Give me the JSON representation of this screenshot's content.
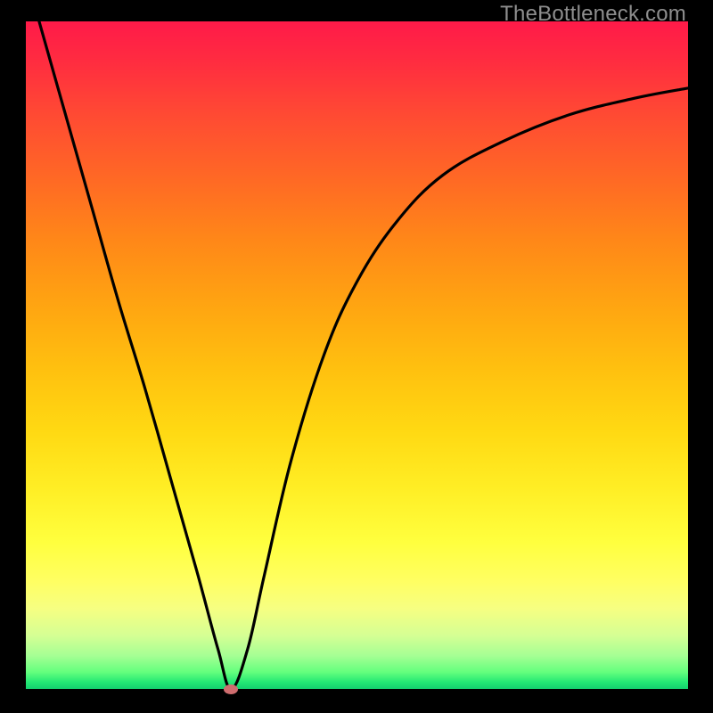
{
  "watermark": "TheBottleneck.com",
  "chart_data": {
    "type": "line",
    "title": "",
    "xlabel": "",
    "ylabel": "",
    "xlim": [
      0,
      100
    ],
    "ylim": [
      0,
      100
    ],
    "grid": false,
    "note": "V-shaped bottleneck curve. x is relative horizontal position (0=left,100=right), y is curve height (0=bottom,100=top). Minimum at x≈31.",
    "series": [
      {
        "name": "bottleneck-curve",
        "x": [
          2,
          6,
          10,
          14,
          18,
          22,
          26,
          29,
          31,
          33.5,
          36,
          40,
          45,
          50,
          56,
          63,
          72,
          82,
          92,
          100
        ],
        "y": [
          100,
          86,
          72,
          58,
          45,
          31,
          17,
          6,
          0,
          6,
          17,
          34,
          50,
          61,
          70,
          77,
          82,
          86,
          88.5,
          90
        ]
      }
    ],
    "min_point": {
      "x": 31,
      "y": 0
    },
    "colors": {
      "curve": "#000000",
      "min_marker": "#cf6d6f",
      "gradient_top": "#ff1a49",
      "gradient_bottom": "#14d06f"
    }
  }
}
